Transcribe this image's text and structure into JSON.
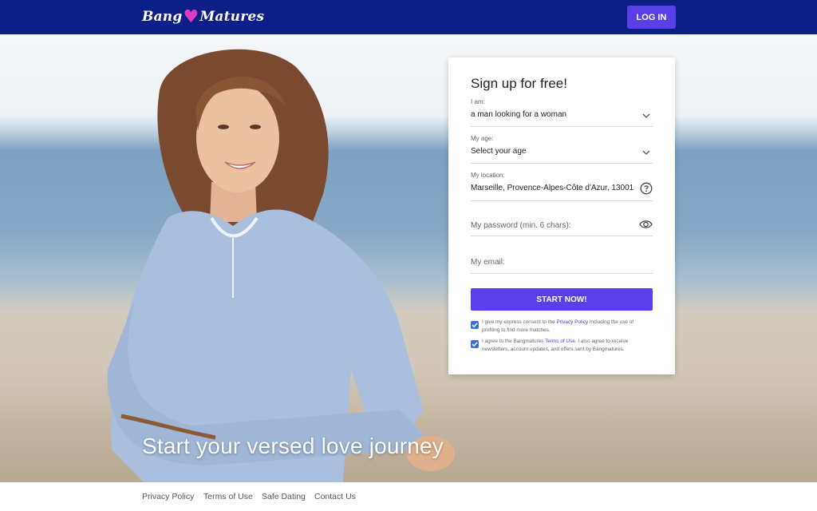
{
  "header": {
    "logo_part1": "Bang",
    "logo_part2": "Matures",
    "login_label": "LOG IN"
  },
  "hero": {
    "tagline": "Start your versed love journey"
  },
  "signup": {
    "title": "Sign up for free!",
    "iam_label": "I am:",
    "iam_value": "a man looking for a woman",
    "age_label": "My age:",
    "age_value": "Select your age",
    "location_label": "My location:",
    "location_value": "Marseille, Provence-Alpes-Côte d'Azur, 13001",
    "password_placeholder": "My password (min. 6 chars):",
    "email_placeholder": "My email:",
    "start_label": "START NOW!",
    "consent1_pre": "I give my express consent to the ",
    "consent1_link": "Privacy Policy",
    "consent1_post": " including the use of profiling to find more matches.",
    "consent1_checked": true,
    "consent2_pre": "I agree to the Bangmatures ",
    "consent2_link": "Terms of Use",
    "consent2_post": ". I also agree to receive newsletters, account updates, and offers sent by Bangmatures.",
    "consent2_checked": true
  },
  "footer": {
    "links": [
      "Privacy Policy",
      "Terms of Use",
      "Safe Dating",
      "Contact Us"
    ]
  },
  "colors": {
    "header_bg": "#0b1f87",
    "accent": "#5b3fe6",
    "logo_heart": "#e03ac6",
    "checkbox": "#3b6ed8"
  },
  "icons": [
    "heart-icon",
    "chevron-down-icon",
    "help-circle-icon",
    "eye-icon",
    "check-icon"
  ]
}
